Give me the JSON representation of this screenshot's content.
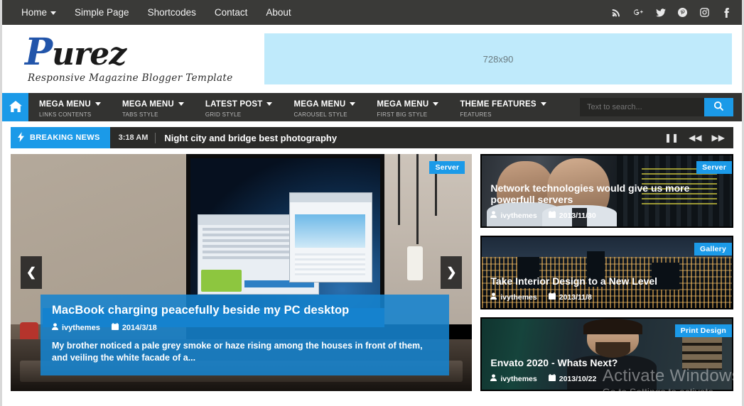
{
  "topbar": {
    "nav": [
      {
        "label": "Home",
        "has_caret": true
      },
      {
        "label": "Simple Page",
        "has_caret": false
      },
      {
        "label": "Shortcodes",
        "has_caret": false
      },
      {
        "label": "Contact",
        "has_caret": false
      },
      {
        "label": "About",
        "has_caret": false
      }
    ],
    "social": [
      {
        "name": "rss-icon"
      },
      {
        "name": "google-plus-icon"
      },
      {
        "name": "twitter-icon"
      },
      {
        "name": "pinterest-icon"
      },
      {
        "name": "instagram-icon"
      },
      {
        "name": "facebook-icon"
      }
    ]
  },
  "header": {
    "logo_text": "Purez",
    "logo_initial": "P",
    "logo_rest": "urez",
    "tagline": "Responsive Magazine Blogger Template",
    "banner_label": "728x90"
  },
  "mainmenu": {
    "home_icon": "home-icon",
    "items": [
      {
        "title": "MEGA MENU",
        "sub": "LINKS CONTENTS",
        "caret": true
      },
      {
        "title": "MEGA MENU",
        "sub": "TABS STYLE",
        "caret": true
      },
      {
        "title": "LATEST POST",
        "sub": "GRID STYLE",
        "caret": true
      },
      {
        "title": "MEGA MENU",
        "sub": "CAROUSEL STYLE",
        "caret": true
      },
      {
        "title": "MEGA MENU",
        "sub": "FIRST BIG STYLE",
        "caret": true
      },
      {
        "title": "THEME FEATURES",
        "sub": "FEATURES",
        "caret": true
      }
    ],
    "search": {
      "placeholder": "Text to search...",
      "value": "",
      "button_icon": "search-icon"
    }
  },
  "breaking": {
    "label": "BREAKING NEWS",
    "icon": "lightning-bolt-icon",
    "time": "3:18 AM",
    "headline": "Night city and bridge best photography",
    "controls": [
      {
        "name": "pause-button",
        "glyph": "❚❚"
      },
      {
        "name": "previous-button",
        "glyph": "◀◀"
      },
      {
        "name": "next-button",
        "glyph": "▶▶"
      }
    ]
  },
  "slider": {
    "badge": "Server",
    "prev_glyph": "❮",
    "next_glyph": "❯",
    "title": "MacBook charging peacefully beside my PC desktop",
    "author": "ivythemes",
    "date": "2014/3/18",
    "excerpt": "My brother noticed a pale grey smoke or haze rising among the houses in front of them, and veiling the white facade of a..."
  },
  "sidebar_posts": [
    {
      "badge": "Server",
      "title": "Network technologies would give us more powerfull servers",
      "author": "ivythemes",
      "date": "2013/11/30"
    },
    {
      "badge": "Gallery",
      "title": "Take Interior Design to a New Level",
      "author": "ivythemes",
      "date": "2013/11/8"
    },
    {
      "badge": "Print Design",
      "title": "Envato 2020 - Whats Next?",
      "author": "ivythemes",
      "date": "2013/10/22"
    }
  ],
  "watermark": {
    "line1": "Activate Windows",
    "line2": "Go to Settings to activate"
  },
  "colors": {
    "accent": "#1b9ae8",
    "topbar": "#3a3a38",
    "menubar": "#333331",
    "banner": "#bfeafb"
  }
}
